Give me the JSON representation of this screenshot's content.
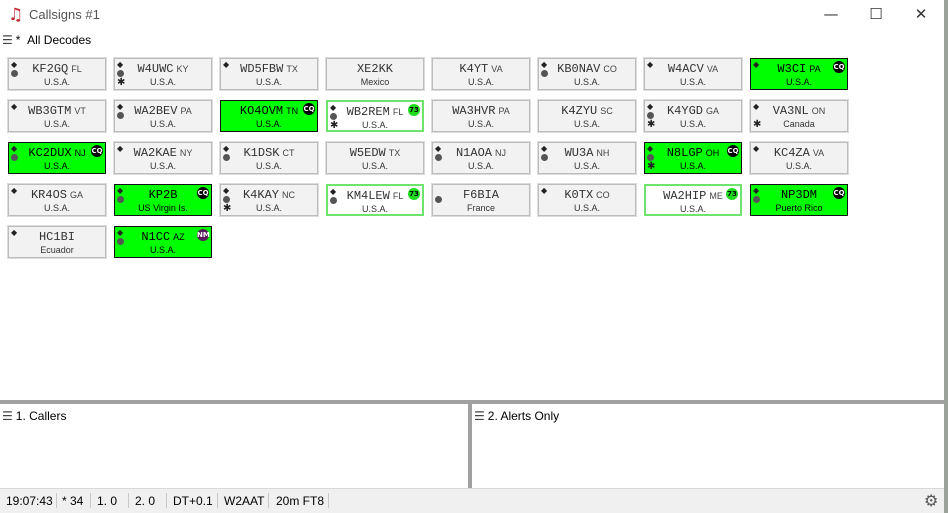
{
  "window": {
    "title": "Callsigns #1",
    "icon": "music-note-icon",
    "controls": {
      "minimize": "—",
      "maximize": "☐",
      "close": "✕"
    }
  },
  "list_header": {
    "marker": "*",
    "label": "All Decodes"
  },
  "tiles": [
    {
      "call": "KF2GQ",
      "state": "FL",
      "country": "U.S.A.",
      "style": "normal",
      "ind": [
        "diamond",
        "dot"
      ],
      "badge": ""
    },
    {
      "call": "W4UWC",
      "state": "KY",
      "country": "U.S.A.",
      "style": "normal",
      "ind": [
        "diamond",
        "dot",
        "star"
      ],
      "badge": ""
    },
    {
      "call": "WD5FBW",
      "state": "TX",
      "country": "U.S.A.",
      "style": "normal",
      "ind": [
        "diamond"
      ],
      "badge": ""
    },
    {
      "call": "XE2KK",
      "state": "",
      "country": "Mexico",
      "style": "normal",
      "ind": [],
      "badge": ""
    },
    {
      "call": "K4YT",
      "state": "VA",
      "country": "U.S.A.",
      "style": "normal",
      "ind": [],
      "badge": ""
    },
    {
      "call": "KB0NAV",
      "state": "CO",
      "country": "U.S.A.",
      "style": "normal",
      "ind": [
        "diamond",
        "dot"
      ],
      "badge": ""
    },
    {
      "call": "W4ACV",
      "state": "VA",
      "country": "U.S.A.",
      "style": "normal",
      "ind": [
        "diamond"
      ],
      "badge": ""
    },
    {
      "call": "W3CI",
      "state": "PA",
      "country": "U.S.A.",
      "style": "cq",
      "ind": [
        "diamond"
      ],
      "badge": "CQ"
    },
    {
      "call": "WB3GTM",
      "state": "VT",
      "country": "U.S.A.",
      "style": "normal",
      "ind": [
        "diamond"
      ],
      "badge": ""
    },
    {
      "call": "WA2BEV",
      "state": "PA",
      "country": "U.S.A.",
      "style": "normal",
      "ind": [
        "diamond",
        "dot"
      ],
      "badge": ""
    },
    {
      "call": "KO4OVM",
      "state": "TN",
      "country": "U.S.A.",
      "style": "cq",
      "ind": [],
      "badge": "CQ"
    },
    {
      "call": "WB2REM",
      "state": "FL",
      "country": "U.S.A.",
      "style": "g73",
      "ind": [
        "diamond",
        "dot",
        "star"
      ],
      "badge": "73"
    },
    {
      "call": "WA3HVR",
      "state": "PA",
      "country": "U.S.A.",
      "style": "normal",
      "ind": [],
      "badge": ""
    },
    {
      "call": "K4ZYU",
      "state": "SC",
      "country": "U.S.A.",
      "style": "normal",
      "ind": [],
      "badge": ""
    },
    {
      "call": "K4YGD",
      "state": "GA",
      "country": "U.S.A.",
      "style": "normal",
      "ind": [
        "diamond",
        "dot",
        "star"
      ],
      "badge": ""
    },
    {
      "call": "VA3NL",
      "state": "ON",
      "country": "Canada",
      "style": "normal",
      "ind": [
        "diamond",
        "star"
      ],
      "badge": ""
    },
    {
      "call": "KC2DUX",
      "state": "NJ",
      "country": "U.S.A.",
      "style": "cq",
      "ind": [
        "diamond",
        "dot"
      ],
      "badge": "CQ"
    },
    {
      "call": "WA2KAE",
      "state": "NY",
      "country": "U.S.A.",
      "style": "normal",
      "ind": [
        "diamond"
      ],
      "badge": ""
    },
    {
      "call": "K1DSK",
      "state": "CT",
      "country": "U.S.A.",
      "style": "normal",
      "ind": [
        "diamond",
        "dot"
      ],
      "badge": ""
    },
    {
      "call": "W5EDW",
      "state": "TX",
      "country": "U.S.A.",
      "style": "normal",
      "ind": [],
      "badge": ""
    },
    {
      "call": "N1AOA",
      "state": "NJ",
      "country": "U.S.A.",
      "style": "normal",
      "ind": [
        "diamond",
        "dot"
      ],
      "badge": ""
    },
    {
      "call": "WU3A",
      "state": "NH",
      "country": "U.S.A.",
      "style": "normal",
      "ind": [
        "diamond",
        "dot"
      ],
      "badge": ""
    },
    {
      "call": "N8LGP",
      "state": "OH",
      "country": "U.S.A.",
      "style": "cq",
      "ind": [
        "diamond",
        "dot",
        "star"
      ],
      "badge": "CQ"
    },
    {
      "call": "KC4ZA",
      "state": "VA",
      "country": "U.S.A.",
      "style": "normal",
      "ind": [
        "diamond"
      ],
      "badge": ""
    },
    {
      "call": "KR4OS",
      "state": "GA",
      "country": "U.S.A.",
      "style": "normal",
      "ind": [
        "diamond"
      ],
      "badge": ""
    },
    {
      "call": "KP2B",
      "state": "",
      "country": "US Virgin Is.",
      "style": "cq",
      "ind": [
        "diamond",
        "dot"
      ],
      "badge": "CQ"
    },
    {
      "call": "K4KAY",
      "state": "NC",
      "country": "U.S.A.",
      "style": "normal",
      "ind": [
        "diamond",
        "dot",
        "star"
      ],
      "badge": ""
    },
    {
      "call": "KM4LEW",
      "state": "FL",
      "country": "U.S.A.",
      "style": "g73",
      "ind": [
        "diamond",
        "dot"
      ],
      "badge": "73"
    },
    {
      "call": "F6BIA",
      "state": "",
      "country": "France",
      "style": "normal",
      "ind": [
        "dot"
      ],
      "badge": ""
    },
    {
      "call": "K0TX",
      "state": "CO",
      "country": "U.S.A.",
      "style": "normal",
      "ind": [
        "diamond"
      ],
      "badge": ""
    },
    {
      "call": "WA2HIP",
      "state": "ME",
      "country": "U.S.A.",
      "style": "g73",
      "ind": [],
      "badge": "73"
    },
    {
      "call": "NP3DM",
      "state": "",
      "country": "Puerto Rico",
      "style": "cq",
      "ind": [
        "diamond",
        "dot"
      ],
      "badge": "CQ"
    },
    {
      "call": "HC1BI",
      "state": "",
      "country": "Ecuador",
      "style": "normal",
      "ind": [
        "diamond"
      ],
      "badge": ""
    },
    {
      "call": "N1CC",
      "state": "AZ",
      "country": "U.S.A.",
      "style": "cq",
      "ind": [
        "diamond",
        "dot"
      ],
      "badge": "NM"
    }
  ],
  "panes": {
    "left": {
      "title": "1.  Callers"
    },
    "right": {
      "title": "2. Alerts Only"
    }
  },
  "status": {
    "time": "19:07:43",
    "all_count": "* 34",
    "list1": "1.  0",
    "list2": "2.  0",
    "dt": "DT+0.1",
    "mycall": "W2AAT",
    "band_mode": "20m FT8"
  },
  "colors": {
    "cq_fill": "#00ff00",
    "badge_73": "#1fdc1f",
    "badge_nm": "#5a1a5e",
    "tile_fill": "#f2f2f2"
  }
}
